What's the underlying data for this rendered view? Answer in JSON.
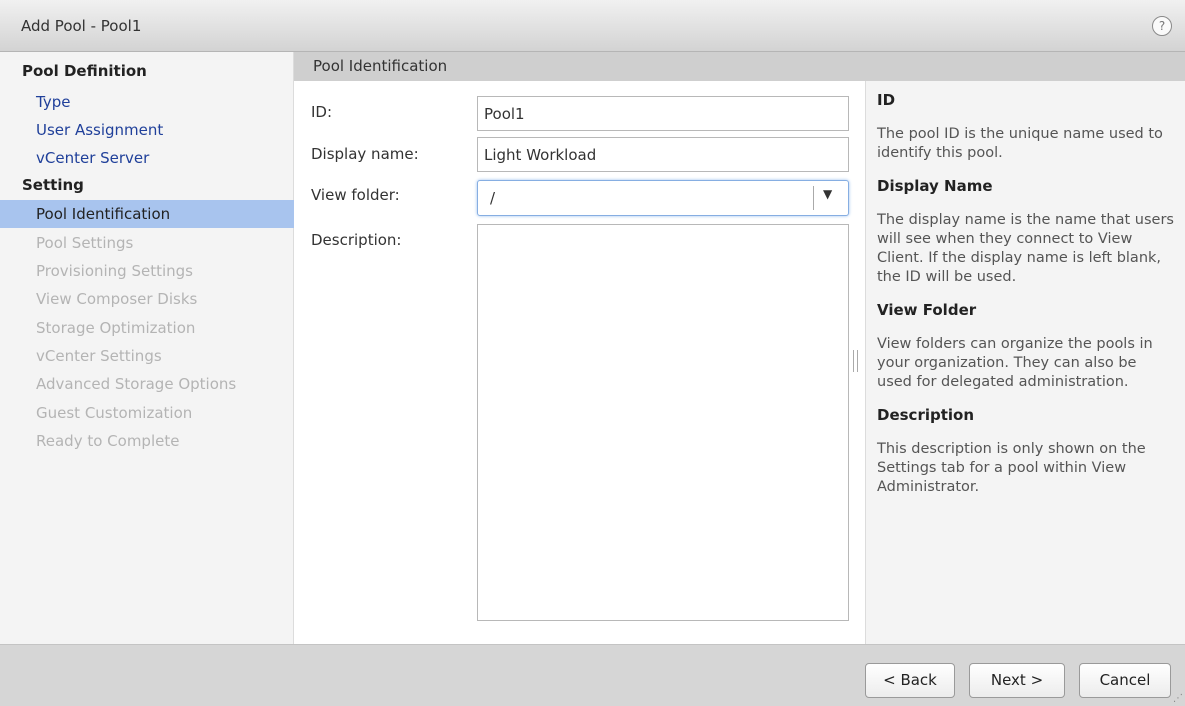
{
  "window": {
    "title": "Add Pool - Pool1",
    "help_label": "?"
  },
  "sidebar": {
    "section1": "Pool Definition",
    "items1": [
      "Type",
      "User Assignment",
      "vCenter Server"
    ],
    "section2": "Setting",
    "active_item": "Pool Identification",
    "items2": [
      "Pool Settings",
      "Provisioning Settings",
      "View Composer Disks",
      "Storage Optimization",
      "vCenter Settings",
      "Advanced Storage Options",
      "Guest Customization",
      "Ready to Complete"
    ]
  },
  "main": {
    "header": "Pool Identification",
    "id_label": "ID:",
    "id_value": "Pool1",
    "display_name_label": "Display name:",
    "display_name_value": "Light Workload",
    "view_folder_label": "View folder:",
    "view_folder_value": "/",
    "description_label": "Description:",
    "description_value": ""
  },
  "help": [
    {
      "title": "ID",
      "text": "The pool ID is the unique name used to identify this pool."
    },
    {
      "title": "Display Name",
      "text": "The display name is the name that users will see when they connect to View Client. If the display name is left blank, the ID will be used."
    },
    {
      "title": "View Folder",
      "text": "View folders can organize the pools in your organization. They can also be used for delegated administration."
    },
    {
      "title": "Description",
      "text": "This description is only shown on the Settings tab for a pool within View Administrator."
    }
  ],
  "footer": {
    "back_label": "< Back",
    "next_label": "Next >",
    "cancel_label": "Cancel"
  },
  "colors": {
    "active_item_bg": "#a8c4ee",
    "link": "#20409a",
    "disabled": "#b4b4b4"
  }
}
